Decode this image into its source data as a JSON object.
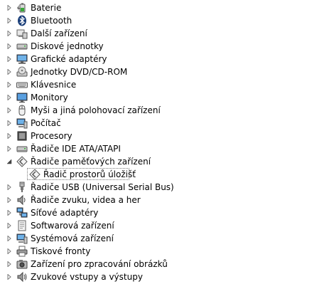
{
  "tree": {
    "items": [
      {
        "label": "Baterie",
        "icon": "battery-icon",
        "expanded": false
      },
      {
        "label": "Bluetooth",
        "icon": "bluetooth-icon",
        "expanded": false
      },
      {
        "label": "Další zařízení",
        "icon": "other-devices-icon",
        "expanded": false
      },
      {
        "label": "Diskové jednotky",
        "icon": "disk-drive-icon",
        "expanded": false
      },
      {
        "label": "Grafické adaptéry",
        "icon": "display-adapter-icon",
        "expanded": false
      },
      {
        "label": "Jednotky DVD/CD-ROM",
        "icon": "dvd-drive-icon",
        "expanded": false
      },
      {
        "label": "Klávesnice",
        "icon": "keyboard-icon",
        "expanded": false
      },
      {
        "label": "Monitory",
        "icon": "monitor-icon",
        "expanded": false
      },
      {
        "label": "Myši a jiná polohovací zařízení",
        "icon": "mouse-icon",
        "expanded": false
      },
      {
        "label": "Počítač",
        "icon": "computer-icon",
        "expanded": false
      },
      {
        "label": "Procesory",
        "icon": "processor-icon",
        "expanded": false
      },
      {
        "label": "Řadiče IDE ATA/ATAPI",
        "icon": "ide-controller-icon",
        "expanded": false
      },
      {
        "label": "Řadiče paměťových zařízení",
        "icon": "storage-controller-icon",
        "expanded": true,
        "children": [
          {
            "label": "Řadič prostorů úložišť",
            "icon": "storage-spaces-icon",
            "selected": true
          }
        ]
      },
      {
        "label": "Řadiče USB (Universal Serial Bus)",
        "icon": "usb-icon",
        "expanded": false
      },
      {
        "label": "Řadiče zvuku, videa a her",
        "icon": "sound-icon",
        "expanded": false
      },
      {
        "label": "Síťové adaptéry",
        "icon": "network-adapter-icon",
        "expanded": false
      },
      {
        "label": "Softwarová zařízení",
        "icon": "software-device-icon",
        "expanded": false
      },
      {
        "label": "Systémová zařízení",
        "icon": "system-device-icon",
        "expanded": false
      },
      {
        "label": "Tiskové fronty",
        "icon": "printer-icon",
        "expanded": false
      },
      {
        "label": "Zařízení pro zpracování obrázků",
        "icon": "camera-icon",
        "expanded": false
      },
      {
        "label": "Zvukové vstupy a výstupy",
        "icon": "speaker-icon",
        "expanded": false
      }
    ]
  }
}
